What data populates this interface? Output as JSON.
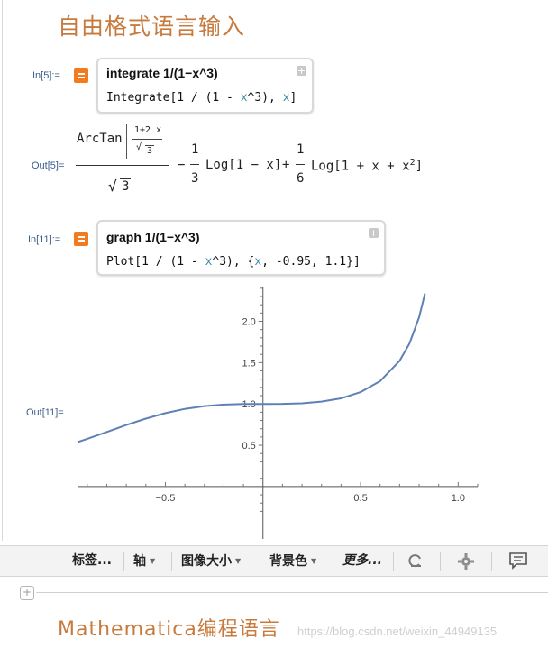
{
  "heading_top": "自由格式语言输入",
  "cell1": {
    "in_label": "In[5]:=",
    "query": "integrate 1/(1−x^3)",
    "code_parts": [
      "Integrate[1 / (1 - ",
      "x",
      "^3), ",
      "x",
      "]"
    ],
    "out_label": "Out[5]=",
    "result": {
      "arctan": "ArcTan",
      "inner_num": "1+2 x",
      "inner_den": "3",
      "den": "3",
      "minus": "−",
      "one_a": "1",
      "three": "3",
      "log1": "Log[1 − x]",
      "plus": "+",
      "one_b": "1",
      "six": "6",
      "log2": "Log[1 + x + x",
      "exp": "2",
      "close": "]"
    }
  },
  "cell2": {
    "in_label": "In[11]:=",
    "query": "graph 1/(1−x^3)",
    "code_parts": [
      "Plot[1 / (1 - ",
      "x",
      "^3), {",
      "x",
      ", -0.95, 1.1}]"
    ],
    "out_label": "Out[11]="
  },
  "chart_data": {
    "type": "line",
    "function": "1/(1-x^3)",
    "x": [
      -0.95,
      -0.9,
      -0.8,
      -0.7,
      -0.6,
      -0.5,
      -0.4,
      -0.3,
      -0.2,
      -0.1,
      0.0,
      0.1,
      0.2,
      0.3,
      0.4,
      0.5,
      0.6,
      0.7,
      0.75,
      0.8,
      0.83
    ],
    "y": [
      0.538,
      0.578,
      0.661,
      0.745,
      0.822,
      0.889,
      0.94,
      0.974,
      0.992,
      0.999,
      1.0,
      1.001,
      1.008,
      1.028,
      1.068,
      1.143,
      1.276,
      1.522,
      1.729,
      2.049,
      2.337
    ],
    "xticks": [
      -0.5,
      0.5,
      1.0
    ],
    "xtick_labels": [
      "−0.5",
      "0.5",
      "1.0"
    ],
    "yticks": [
      0.5,
      1.0,
      1.5,
      2.0
    ],
    "ytick_labels": [
      "0.5",
      "1.0",
      "1.5",
      "2.0"
    ],
    "xlim": [
      -0.95,
      1.1
    ],
    "ylim": [
      -0.35,
      2.42
    ],
    "line_color": "#5e81b5",
    "grid": false
  },
  "toolbar": {
    "labels": "标签...",
    "axis": "轴",
    "image_size": "图像大小",
    "background": "背景色",
    "more": "更多..."
  },
  "heading_bottom": "Mathematica编程语言",
  "watermark": "https://blog.csdn.net/weixin_44949135",
  "colors": {
    "accent": "#f47a1f",
    "heading": "#c87a3d",
    "label": "#3c5d8a",
    "var": "#3c8da6"
  }
}
